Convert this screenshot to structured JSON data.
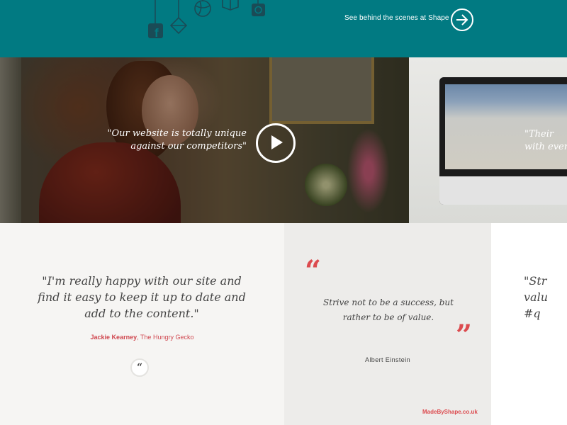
{
  "header": {
    "behind_link": "See behind the scenes at Shape",
    "accent_color": "#017a82"
  },
  "hanging_icons": [
    "facebook-icon",
    "diamond-icon",
    "basketball-icon",
    "cube-icon",
    "instagram-icon"
  ],
  "video_slides": [
    {
      "quote": "\"Our website is totally unique against our competitors\"",
      "has_play_button": true
    },
    {
      "quote": "\"Their with ever"
    }
  ],
  "testimonials": [
    {
      "quote": "\"I'm really happy with our site and find it easy to keep it up to date and add to the content.\"",
      "author_name": "Jackie Kearney",
      "author_company": ", The Hungry Gecko"
    },
    {
      "quote": "Strive not to be a success, but rather to be of value.",
      "author": "Albert Einstein",
      "site": "MadeByShape.co.uk",
      "quote_open": "“",
      "quote_close": "”"
    },
    {
      "quote": "\"Str valu #q"
    }
  ],
  "badge_glyph": "“",
  "colors": {
    "brand_red": "#dc4b4f",
    "text": "#444444"
  }
}
